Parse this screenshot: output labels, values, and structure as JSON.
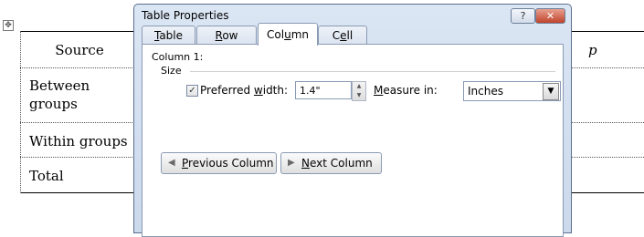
{
  "document": {
    "table_move_handle_icon": "move-handle-icon",
    "table": {
      "header": [
        "Source",
        "p"
      ],
      "rows": [
        "Between groups",
        "Within groups",
        "Total"
      ]
    }
  },
  "dialog": {
    "title": "Table Properties",
    "help_icon": "help-icon",
    "close_icon": "close-icon",
    "tabs": [
      {
        "pre": "",
        "ul": "T",
        "post": "able",
        "active": false
      },
      {
        "pre": "",
        "ul": "R",
        "post": "ow",
        "active": false
      },
      {
        "pre": "Col",
        "ul": "u",
        "post": "mn",
        "active": true
      },
      {
        "pre": "C",
        "ul": "e",
        "post": "ll",
        "active": false
      }
    ],
    "column_heading": "Column 1:",
    "size_label": "Size",
    "preferred_width": {
      "checked": true,
      "label_pre": "Preferred ",
      "label_ul": "w",
      "label_post": "idth:",
      "value": "1.4\""
    },
    "measure_in": {
      "label_pre": "",
      "label_ul": "M",
      "label_post": "easure in:",
      "value": "Inches"
    },
    "buttons": {
      "previous": {
        "pre": "",
        "ul": "P",
        "post": "revious Column"
      },
      "next": {
        "pre": "",
        "ul": "N",
        "post": "ext Column"
      }
    }
  }
}
